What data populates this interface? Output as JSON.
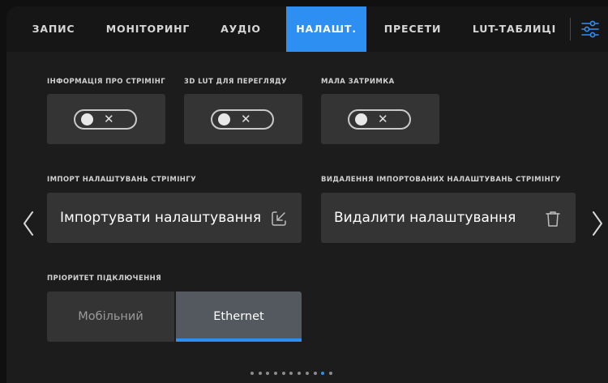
{
  "tabs": [
    {
      "label": "ЗАПИС",
      "active": false
    },
    {
      "label": "МОНІТОРИНГ",
      "active": false
    },
    {
      "label": "АУДІО",
      "active": false
    },
    {
      "label": "НАЛАШТ.",
      "active": true
    },
    {
      "label": "ПРЕСЕТИ",
      "active": false
    },
    {
      "label": "LUT-ТАБЛИЦІ",
      "active": false
    }
  ],
  "toggles": [
    {
      "label": "ІНФОРМАЦІЯ ПРО СТРІМІНГ",
      "state": "off",
      "icon": "x-icon"
    },
    {
      "label": "3D LUT ДЛЯ ПЕРЕГЛЯДУ",
      "state": "off",
      "icon": "x-icon"
    },
    {
      "label": "МАЛА ЗАТРИМКА",
      "state": "off",
      "icon": "x-icon"
    }
  ],
  "import": {
    "section_label": "ІМПОРТ НАЛАШТУВАНЬ СТРІМІНГУ",
    "button_label": "Імпортувати налаштування",
    "icon": "import-icon"
  },
  "delete": {
    "section_label": "ВИДАЛЕННЯ ІМПОРТОВАНИХ НАЛАШТУВАНЬ СТРІМІНГУ",
    "button_label": "Видалити налаштування",
    "icon": "trash-icon"
  },
  "priority": {
    "section_label": "ПРІОРИТЕТ ПІДКЛЮЧЕННЯ",
    "options": [
      "Мобільний",
      "Ethernet"
    ],
    "selected": "Ethernet"
  },
  "pagination": {
    "total": 11,
    "current": 10
  },
  "colors": {
    "accent": "#2e8ff2",
    "panel": "#343434",
    "background": "#1c1c1c"
  }
}
